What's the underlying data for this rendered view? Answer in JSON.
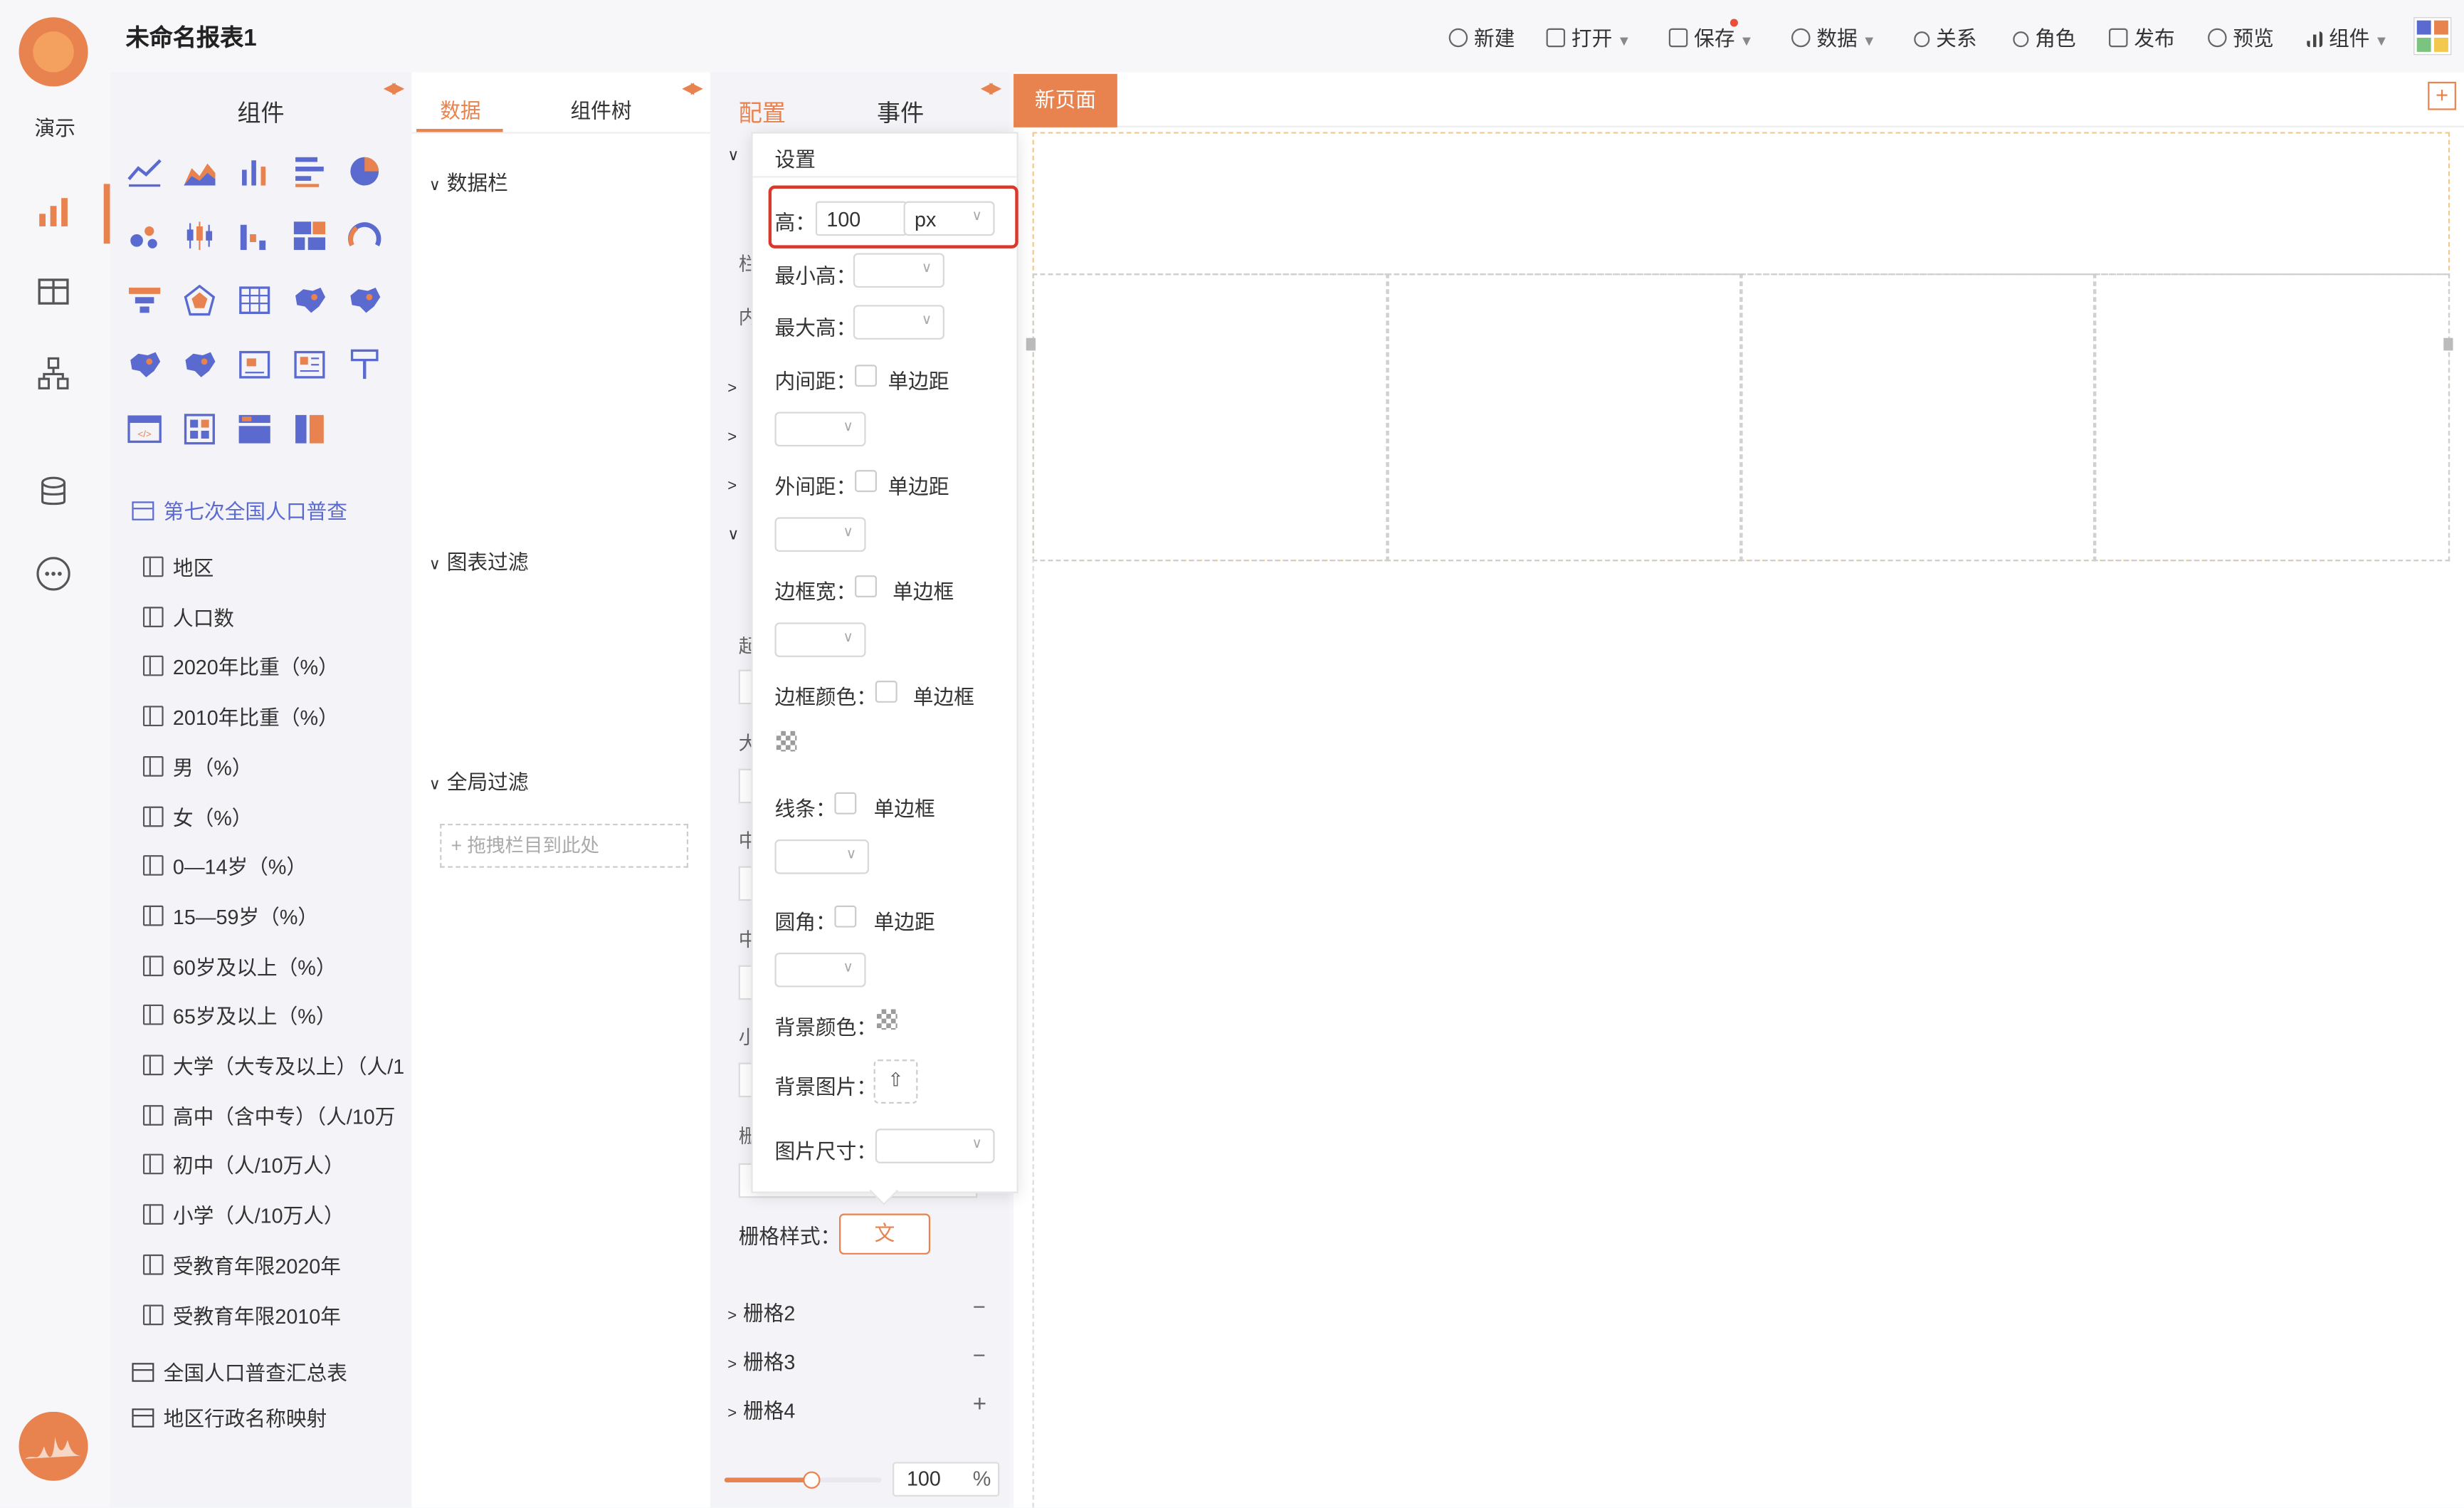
{
  "app": {
    "nav_label": "演示",
    "colors": {
      "accent": "#e8834f",
      "link_blue": "#5a6acf",
      "highlight_red": "#d9382a"
    }
  },
  "header": {
    "title": "未命名报表1",
    "toolbar": [
      {
        "label": "新建",
        "icon": "plus-circle-icon"
      },
      {
        "label": "打开",
        "icon": "folder-icon",
        "dropdown": true
      },
      {
        "label": "保存",
        "icon": "save-icon",
        "dropdown": true,
        "badge": true
      },
      {
        "label": "数据",
        "icon": "database-icon",
        "dropdown": true
      },
      {
        "label": "关系",
        "icon": "relation-icon"
      },
      {
        "label": "角色",
        "icon": "user-icon"
      },
      {
        "label": "发布",
        "icon": "edit-icon"
      },
      {
        "label": "预览",
        "icon": "play-circle-icon"
      },
      {
        "label": "组件",
        "icon": "bar-chart-icon",
        "dropdown": true
      }
    ]
  },
  "component_panel": {
    "title": "组件",
    "icons": [
      "line-chart-icon",
      "area-chart-icon",
      "bar-chart-icon",
      "horizontal-bar-icon",
      "pie-chart-icon",
      "scatter-chart-icon",
      "candlestick-chart-icon",
      "waterfall-chart-icon",
      "treemap-icon",
      "gauge-icon",
      "funnel-chart-icon",
      "radar-chart-icon",
      "table-icon",
      "china-map-icon",
      "china-map-flow-icon",
      "china-map-heat-icon",
      "china-map-bubble-icon",
      "image-widget-icon",
      "text-widget-icon",
      "brush-icon",
      "html-widget-icon",
      "grid-layout-icon",
      "tabs-layout-icon",
      "column-layout-icon"
    ],
    "dataset": {
      "name": "第七次全国人口普查",
      "fields": [
        "地区",
        "人口数",
        "2020年比重（%）",
        "2010年比重（%）",
        "男（%）",
        "女（%）",
        "0—14岁（%）",
        "15—59岁（%）",
        "60岁及以上（%）",
        "65岁及以上（%）",
        "大学（大专及以上）（人/1",
        "高中（含中专）（人/10万",
        "初中（人/10万人）",
        "小学（人/10万人）",
        "受教育年限2020年",
        "受教育年限2010年"
      ]
    },
    "other_tables": [
      "全国人口普查汇总表",
      "地区行政名称映射"
    ]
  },
  "data_panel": {
    "tabs": [
      "数据",
      "组件树"
    ],
    "sections": [
      "数据栏",
      "图表过滤",
      "全局过滤"
    ],
    "drop_hint": "+ 拖拽栏目到此处"
  },
  "config_panel": {
    "tabs": [
      "配置",
      "事件"
    ],
    "grid_style_label": "栅格样式：",
    "grid_style_button": "文",
    "grid_items": [
      {
        "label": "栅格2",
        "action": "−"
      },
      {
        "label": "栅格3",
        "action": "−"
      },
      {
        "label": "栅格4",
        "action": "+"
      }
    ],
    "zoom": {
      "value": "100",
      "unit": "%",
      "slider_percent": 55
    }
  },
  "popover": {
    "title": "设置",
    "height_label": "高：",
    "height_value": "100",
    "height_unit": "px",
    "min_height_label": "最小高：",
    "max_height_label": "最大高：",
    "padding_label": "内间距：",
    "margin_label": "外间距：",
    "border_width_label": "边框宽：",
    "border_color_label": "边框颜色：",
    "line_label": "线条：",
    "radius_label": "圆角：",
    "single_margin": "单边距",
    "single_border": "单边框",
    "bg_color_label": "背景颜色：",
    "bg_image_label": "背景图片：",
    "image_size_label": "图片尺寸："
  },
  "canvas": {
    "tab": "新页面",
    "add": "+"
  }
}
